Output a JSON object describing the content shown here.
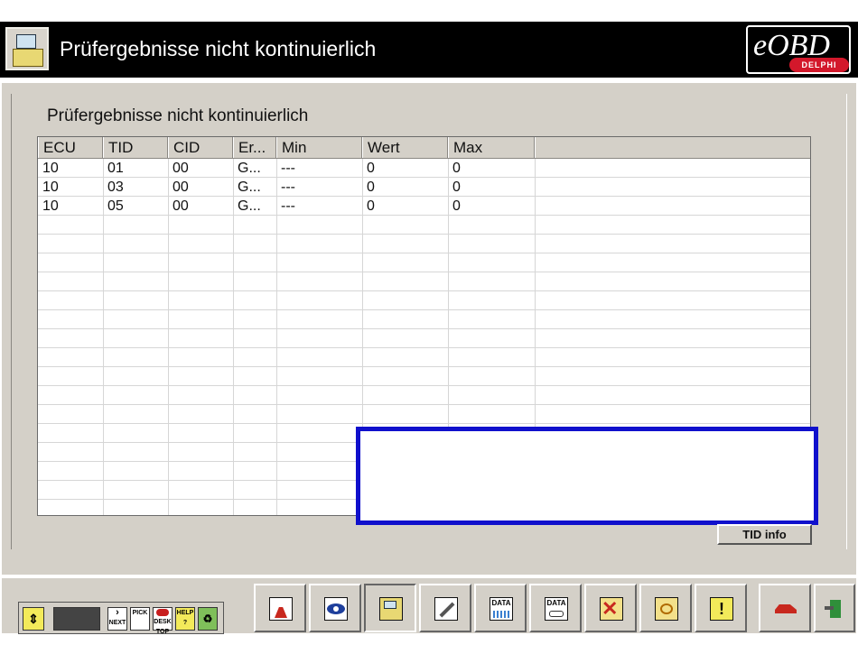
{
  "window": {
    "title": "Prüfergebnisse nicht kontinuierlich"
  },
  "logo": {
    "text": "eOBD",
    "badge": "DELPHI"
  },
  "section": {
    "title": "Prüfergebnisse nicht kontinuierlich"
  },
  "table": {
    "columns": [
      "ECU",
      "TID",
      "CID",
      "Er...",
      "Min",
      "Wert",
      "Max"
    ],
    "rows": [
      [
        "10",
        "01",
        "00",
        "G...",
        "---",
        "0",
        "0"
      ],
      [
        "10",
        "03",
        "00",
        "G...",
        "---",
        "0",
        "0"
      ],
      [
        "10",
        "05",
        "00",
        "G...",
        "---",
        "0",
        "0"
      ]
    ]
  },
  "buttons": {
    "tid_info": "TID info"
  },
  "mini_toolbar": {
    "next": "NEXT",
    "pick": "PICK",
    "desktop": "DESK TOP",
    "help": "HELP ?"
  },
  "toolbar_icons": {
    "data1": "DATA",
    "data2": "DATA"
  }
}
